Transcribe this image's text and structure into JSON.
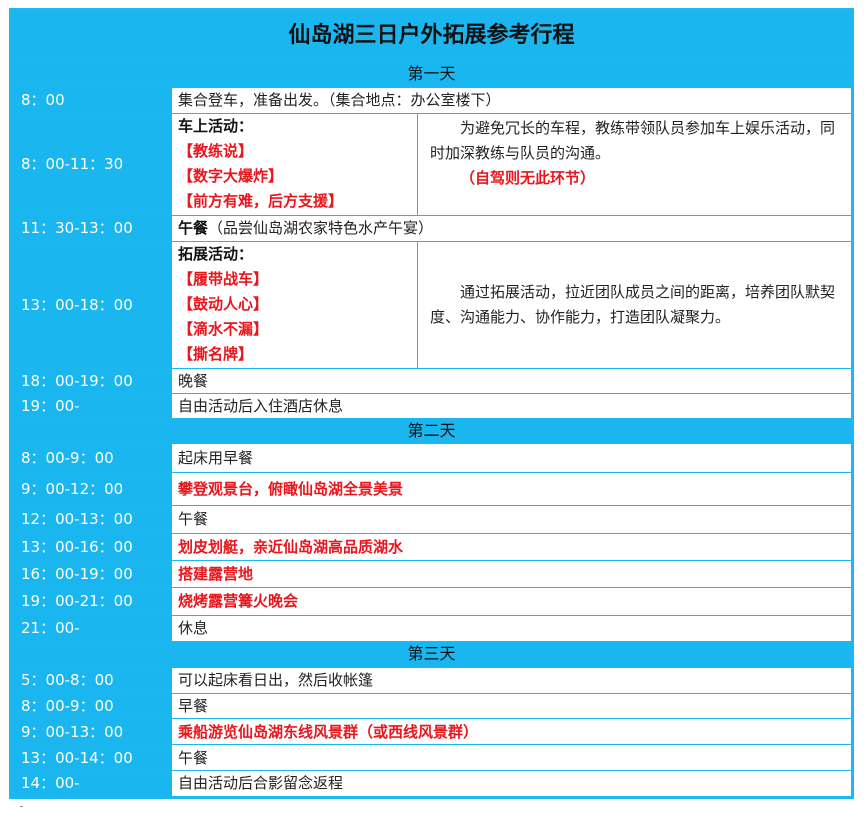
{
  "title": "仙岛湖三日户外拓展参考行程",
  "days": {
    "day1": "第一天",
    "day2": "第二天",
    "day3": "第三天"
  },
  "day1": {
    "r1": {
      "time": "8：00",
      "text": "集合登车，准备出发。（集合地点：办公室楼下）"
    },
    "r2": {
      "time": "8：00-11：30",
      "heading": "车上活动：",
      "items": [
        "【教练说】",
        "【数字大爆炸】",
        "【前方有难，后方支援】"
      ],
      "desc": "为避免冗长的车程，教练带领队员参加车上娱乐活动，同时加深教练与队员的沟通。",
      "note": "（自驾则无此环节）"
    },
    "r3": {
      "time": "11：30-13：00",
      "bold": "午餐",
      "text": "（品尝仙岛湖农家特色水产午宴）"
    },
    "r4": {
      "time": "13：00-18：00",
      "heading": "拓展活动：",
      "items": [
        "【履带战车】",
        "【鼓动人心】",
        "【滴水不漏】",
        "【撕名牌】"
      ],
      "desc": "通过拓展活动，拉近团队成员之间的距离，培养团队默契度、沟通能力、协作能力，打造团队凝聚力。"
    },
    "r5": {
      "time": "18：00-19：00",
      "text": "晚餐"
    },
    "r6": {
      "time": "19：00-",
      "text": "自由活动后入住酒店休息"
    }
  },
  "day2": {
    "r1": {
      "time": "8：00-9：00",
      "text": "起床用早餐"
    },
    "r2": {
      "time": "9：00-12：00",
      "text": "攀登观景台，俯瞰仙岛湖全景美景"
    },
    "r3": {
      "time": "12：00-13：00",
      "text": "午餐"
    },
    "r4": {
      "time": "13：00-16：00",
      "text": "划皮划艇，亲近仙岛湖高品质湖水"
    },
    "r5": {
      "time": "16：00-19：00",
      "text": "搭建露营地"
    },
    "r6": {
      "time": "19：00-21：00",
      "text": "烧烤露营篝火晚会"
    },
    "r7": {
      "time": "21：00-",
      "text": "休息"
    }
  },
  "day3": {
    "r1": {
      "time": "5：00-8：00",
      "text": "可以起床看日出，然后收帐篷"
    },
    "r2": {
      "time": "8：00-9：00",
      "text": "早餐"
    },
    "r3": {
      "time": "9：00-13：00",
      "text": "乘船游览仙岛湖东线风景群（或西线风景群）"
    },
    "r4": {
      "time": "13：00-14：00",
      "text": "午餐"
    },
    "r5": {
      "time": "14：00-",
      "text": "自由活动后合影留念返程"
    }
  },
  "colors": {
    "header_bg": "#1ab6f0",
    "border": "#1fb7ee",
    "highlight": "#e8161d"
  }
}
